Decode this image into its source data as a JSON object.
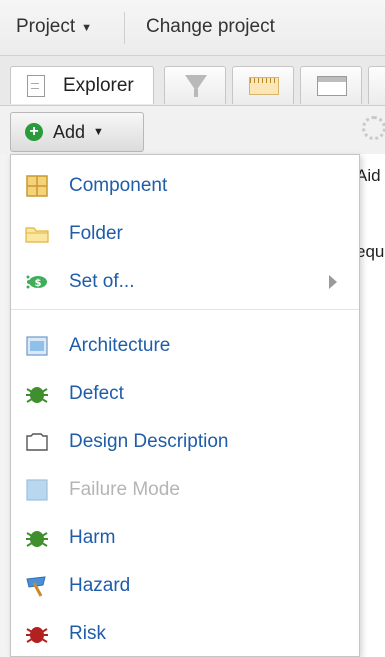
{
  "topbar": {
    "project_label": "Project",
    "change_project_label": "Change project"
  },
  "tabs": {
    "explorer_label": "Explorer"
  },
  "toolbar": {
    "add_label": "Add"
  },
  "background": {
    "text_1": "Aid",
    "text_2": "equ"
  },
  "menu": {
    "items": [
      {
        "label": "Component",
        "icon": "component-icon",
        "enabled": true
      },
      {
        "label": "Folder",
        "icon": "folder-icon",
        "enabled": true
      },
      {
        "label": "Set of...",
        "icon": "set-of-icon",
        "enabled": true,
        "submenu": true
      },
      {
        "label": "Architecture",
        "icon": "architecture-icon",
        "enabled": true
      },
      {
        "label": "Defect",
        "icon": "defect-icon",
        "enabled": true
      },
      {
        "label": "Design Description",
        "icon": "design-description-icon",
        "enabled": true
      },
      {
        "label": "Failure Mode",
        "icon": "failure-mode-icon",
        "enabled": false
      },
      {
        "label": "Harm",
        "icon": "harm-icon",
        "enabled": true
      },
      {
        "label": "Hazard",
        "icon": "hazard-icon",
        "enabled": true
      },
      {
        "label": "Risk",
        "icon": "risk-icon",
        "enabled": true
      }
    ]
  },
  "colors": {
    "link": "#1f5da8",
    "disabled": "#b5b5b5",
    "add_green": "#2a9a3b"
  }
}
